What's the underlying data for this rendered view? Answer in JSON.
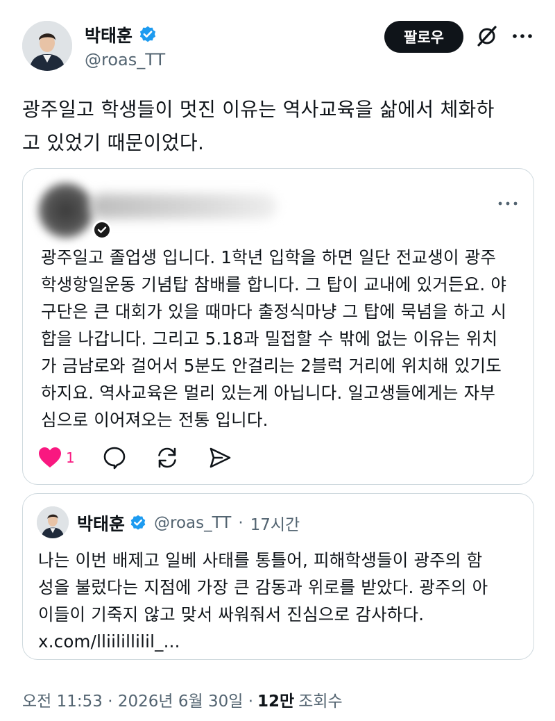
{
  "author": {
    "name": "박태훈",
    "handle": "@roas_TT",
    "verified_color": "#1d9bf0"
  },
  "header": {
    "follow_label": "팔로우",
    "grok_icon": "grok-slash-icon",
    "more_icon": "more-horizontal-icon"
  },
  "tweet": {
    "lines": [
      "광주일고 학생들이 멋진 이유는 역사교육을 삶에서 체화하",
      "고 있었기 때문이었다."
    ]
  },
  "quoted_reply": {
    "author_hidden": true,
    "lines": [
      "광주일고 졸업생 입니다. 1학년 입학을 하면 일단 전교생이 광주",
      "학생항일운동 기념탑 참배를 합니다. 그 탑이 교내에 있거든요. 야",
      "구단은 큰 대회가 있을 때마다 출정식마냥 그 탑에 묵념을 하고 시",
      "합을 나갑니다. 그리고 5.18과 밀접할 수 밖에 없는 이유는 위치",
      "가 금남로와 걸어서 5분도 안걸리는 2블럭 거리에 위치해 있기도",
      "하지요. 역사교육은 멀리 있는게 아닙니다. 일고생들에게는 자부",
      "심으로 이어져오는 전통 입니다."
    ],
    "like_count": "1",
    "like_color": "#f91880"
  },
  "quoted_tweet": {
    "name": "박태훈",
    "handle": "@roas_TT",
    "separator": "·",
    "time": "17시간",
    "lines": [
      "나는 이번 배제고 일베 사태를 통틀어, 피해학생들이 광주의 함",
      "성을 불렀다는 지점에 가장 큰 감동과 위로를 받았다. 광주의 아",
      "이들이 기죽지 않고 맞서 싸워줘서 진심으로 감사하다.",
      "x.com/lliilillilil_..."
    ]
  },
  "footer": {
    "timestamp": "오전 11:53 · 2026년 6월 30일 ·",
    "views_count": "12만",
    "views_label": "조회수"
  }
}
